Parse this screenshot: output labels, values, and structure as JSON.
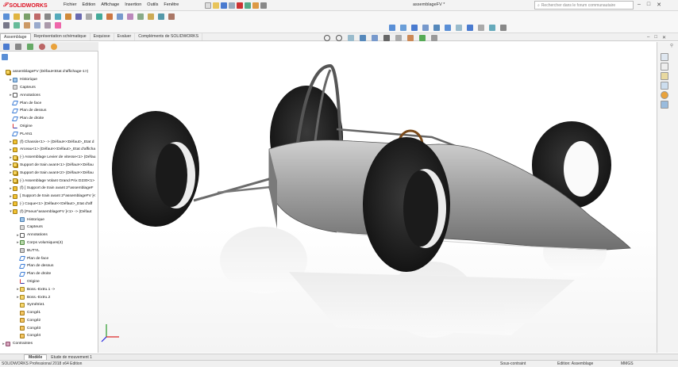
{
  "app": {
    "logo_text": "SOLIDWORKS",
    "doc_title": "assemblageFV *",
    "search_placeholder": "Rechercher dans le forum communautaire"
  },
  "menu": [
    "Fichier",
    "Edition",
    "Affichage",
    "Insertion",
    "Outils",
    "Fenêtre"
  ],
  "tabs": [
    "Assemblage",
    "Représentation schématique",
    "Esquisse",
    "Evaluer",
    "Compléments de SOLIDWORKS"
  ],
  "tree": [
    {
      "label": "assemblageFV  (Défaut<Etat d'affichage-1>)",
      "icon": "asm",
      "depth": 0,
      "expand": ""
    },
    {
      "label": "Historique",
      "icon": "history",
      "depth": 1,
      "expand": "▸"
    },
    {
      "label": "Capteurs",
      "icon": "sensor",
      "depth": 1,
      "expand": ""
    },
    {
      "label": "Annotations",
      "icon": "anno",
      "depth": 1,
      "expand": "▸"
    },
    {
      "label": "Plan de face",
      "icon": "plane",
      "depth": 1,
      "expand": ""
    },
    {
      "label": "Plan de dessus",
      "icon": "plane",
      "depth": 1,
      "expand": ""
    },
    {
      "label": "Plan de droite",
      "icon": "plane",
      "depth": 1,
      "expand": ""
    },
    {
      "label": "Origine",
      "icon": "origin",
      "depth": 1,
      "expand": ""
    },
    {
      "label": "PLAN1",
      "icon": "plane",
      "depth": 1,
      "expand": ""
    },
    {
      "label": "(f) Chassis<1> -> (Défaut<<Défaut>_Etat d",
      "icon": "part",
      "depth": 1,
      "expand": "▸"
    },
    {
      "label": "Arceau<1> (Défaut<<Défaut>_Etat d'afficha",
      "icon": "part",
      "depth": 1,
      "expand": "▸"
    },
    {
      "label": "(-) Assemblage Levier de vitesse<1> (Défau",
      "icon": "asm",
      "depth": 1,
      "expand": "▸"
    },
    {
      "label": "Support de train avant<1> (Défaut<<Défau",
      "icon": "asm",
      "depth": 1,
      "expand": "▸"
    },
    {
      "label": "Support de train avant<2> (Défaut<<Défau",
      "icon": "asm",
      "depth": 1,
      "expand": "▸"
    },
    {
      "label": "(-) Assemblage Volant Grand Prix D230<1>",
      "icon": "asm",
      "depth": 1,
      "expand": "▸"
    },
    {
      "label": "(f) [ Support de train avant 2^assemblageF",
      "icon": "part",
      "depth": 1,
      "expand": "▸"
    },
    {
      "label": "[ Support de train avant 2^assemblageFV ]<",
      "icon": "part",
      "depth": 1,
      "expand": "▸"
    },
    {
      "label": "(-) Coque<1> (Défaut<<Défaut>_Etat d'aff",
      "icon": "part",
      "depth": 1,
      "expand": "▸"
    },
    {
      "label": "(f) [Pneus^assemblageFV ]<1> -> (Défaut",
      "icon": "part",
      "depth": 1,
      "expand": "▾"
    },
    {
      "label": "Historique",
      "icon": "history",
      "depth": 2,
      "expand": ""
    },
    {
      "label": "Capteurs",
      "icon": "sensor",
      "depth": 2,
      "expand": ""
    },
    {
      "label": "Annotations",
      "icon": "anno",
      "depth": 2,
      "expand": "▸"
    },
    {
      "label": "Corps volumiques(4)",
      "icon": "body",
      "depth": 2,
      "expand": "▸"
    },
    {
      "label": "BUTYL",
      "icon": "material",
      "depth": 2,
      "expand": ""
    },
    {
      "label": "Plan de face",
      "icon": "plane",
      "depth": 2,
      "expand": ""
    },
    {
      "label": "Plan de dessus",
      "icon": "plane",
      "depth": 2,
      "expand": ""
    },
    {
      "label": "Plan de droite",
      "icon": "plane",
      "depth": 2,
      "expand": ""
    },
    {
      "label": "Origine",
      "icon": "origin",
      "depth": 2,
      "expand": ""
    },
    {
      "label": "Boss.-Extru.1 ->",
      "icon": "feat",
      "depth": 2,
      "expand": "▸"
    },
    {
      "label": "Boss.-Extru.2",
      "icon": "feat",
      "depth": 2,
      "expand": "▸"
    },
    {
      "label": "Symétrie1",
      "icon": "feat",
      "depth": 2,
      "expand": ""
    },
    {
      "label": "Congé1",
      "icon": "fillet",
      "depth": 2,
      "expand": ""
    },
    {
      "label": "Congé2",
      "icon": "fillet",
      "depth": 2,
      "expand": ""
    },
    {
      "label": "Congé3",
      "icon": "fillet",
      "depth": 2,
      "expand": ""
    },
    {
      "label": "Congé4",
      "icon": "fillet",
      "depth": 2,
      "expand": ""
    },
    {
      "label": "Contraintes",
      "icon": "mate",
      "depth": 0,
      "expand": "▸"
    }
  ],
  "bottom_tabs": [
    "Modèle",
    "Etude de mouvement 1"
  ],
  "status": {
    "product": "SOLIDWORKS Professional 2018 x64 Edition",
    "state": "Sous-contraint",
    "editing": "Edition: Assemblage",
    "units": "MMGS"
  },
  "colors": {
    "brand": "#d12233",
    "tire": "#1c1c1c",
    "body": "#9a9a9a"
  }
}
